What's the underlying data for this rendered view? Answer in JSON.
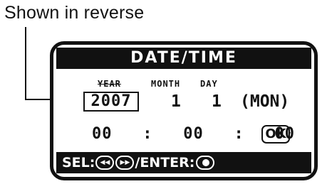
{
  "annotation": {
    "text": "Shown in reverse"
  },
  "screen": {
    "title": "DATE/TIME",
    "labels": {
      "year": "YEAR",
      "month": "MONTH",
      "day": "DAY"
    },
    "date": {
      "year": "2007",
      "month": "1",
      "day": "1",
      "weekday": "(MON)"
    },
    "time": {
      "hour": "00",
      "sep1": ":",
      "minute": "00",
      "sep2": ":",
      "second": "00"
    },
    "ok_label": "OK",
    "footer": {
      "sel_label": "SEL:",
      "prev_icon": "◀◀",
      "next_icon": "▶▶",
      "enter_label": "/ENTER:"
    }
  }
}
